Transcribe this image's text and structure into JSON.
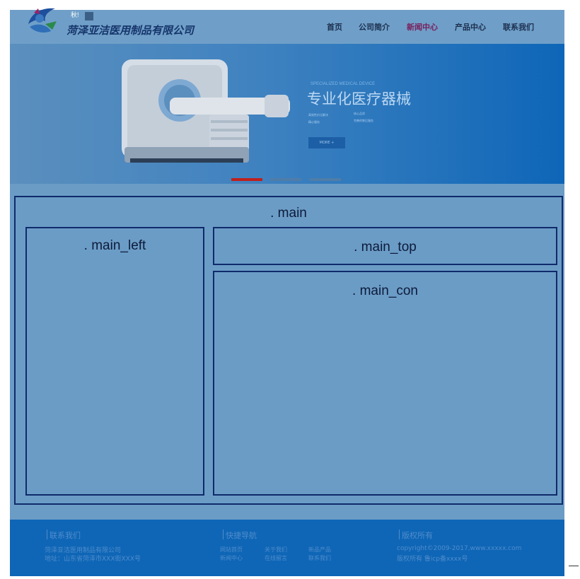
{
  "header": {
    "logo_top_text": "秋!",
    "company_name": "菏泽亚洁医用制品有限公司",
    "nav": [
      "首页",
      "公司简介",
      "新闻中心",
      "产品中心",
      "联系我们"
    ],
    "active_nav": "新闻中心"
  },
  "banner": {
    "subtitle": "SPECIALIZED MEDICAL DEVICE",
    "title": "专业化医疗器械",
    "features": [
      "高效性价比解决",
      "核心品质",
      "精心服务",
      "完善的售后服务"
    ],
    "button": "MORE +"
  },
  "layout_labels": {
    "main": ". main",
    "main_left": ". main_left",
    "main_top": ". main_top",
    "main_con": ". main_con"
  },
  "footer": {
    "contact": {
      "heading": "联系我们",
      "company": "菏泽亚洁医用制品有限公司",
      "address": "地址：山东省菏泽市XXX街XXX号"
    },
    "quick_nav": {
      "heading": "快捷导航",
      "links": [
        "网站首页",
        "关于我们",
        "新闻中心",
        "在线留言",
        "新品产品",
        "联系我们"
      ]
    },
    "copyright": {
      "heading": "版权所有",
      "line1": "copyright©2009-2017,www.xxxxx.com",
      "line2": "版权所有 鲁icp备xxxx号"
    }
  },
  "colors": {
    "page_bg": "#6b9cc6",
    "border": "#0f2a6b",
    "footer_bg": "#0f66b6",
    "active_nav": "#7a1f5c",
    "slider_active": "#c0201c"
  }
}
